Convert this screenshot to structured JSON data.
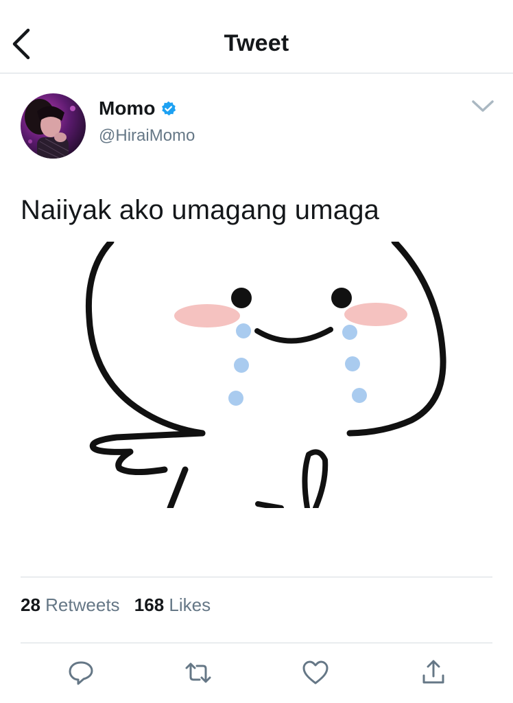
{
  "header": {
    "title": "Tweet"
  },
  "author": {
    "name": "Momo",
    "handle": "@HiraiMomo",
    "verified": true
  },
  "tweet": {
    "text": "Naiiyak ako umagang umaga"
  },
  "stats": {
    "retweets_count": "28",
    "retweets_label": "Retweets",
    "likes_count": "168",
    "likes_label": "Likes"
  },
  "actions": [
    {
      "icon": "reply-icon"
    },
    {
      "icon": "retweet-icon"
    },
    {
      "icon": "like-icon"
    },
    {
      "icon": "share-icon"
    }
  ],
  "colors": {
    "text": "#14171a",
    "secondary": "#657786",
    "accent": "#1da1f2",
    "divider": "#d5dbe0"
  }
}
